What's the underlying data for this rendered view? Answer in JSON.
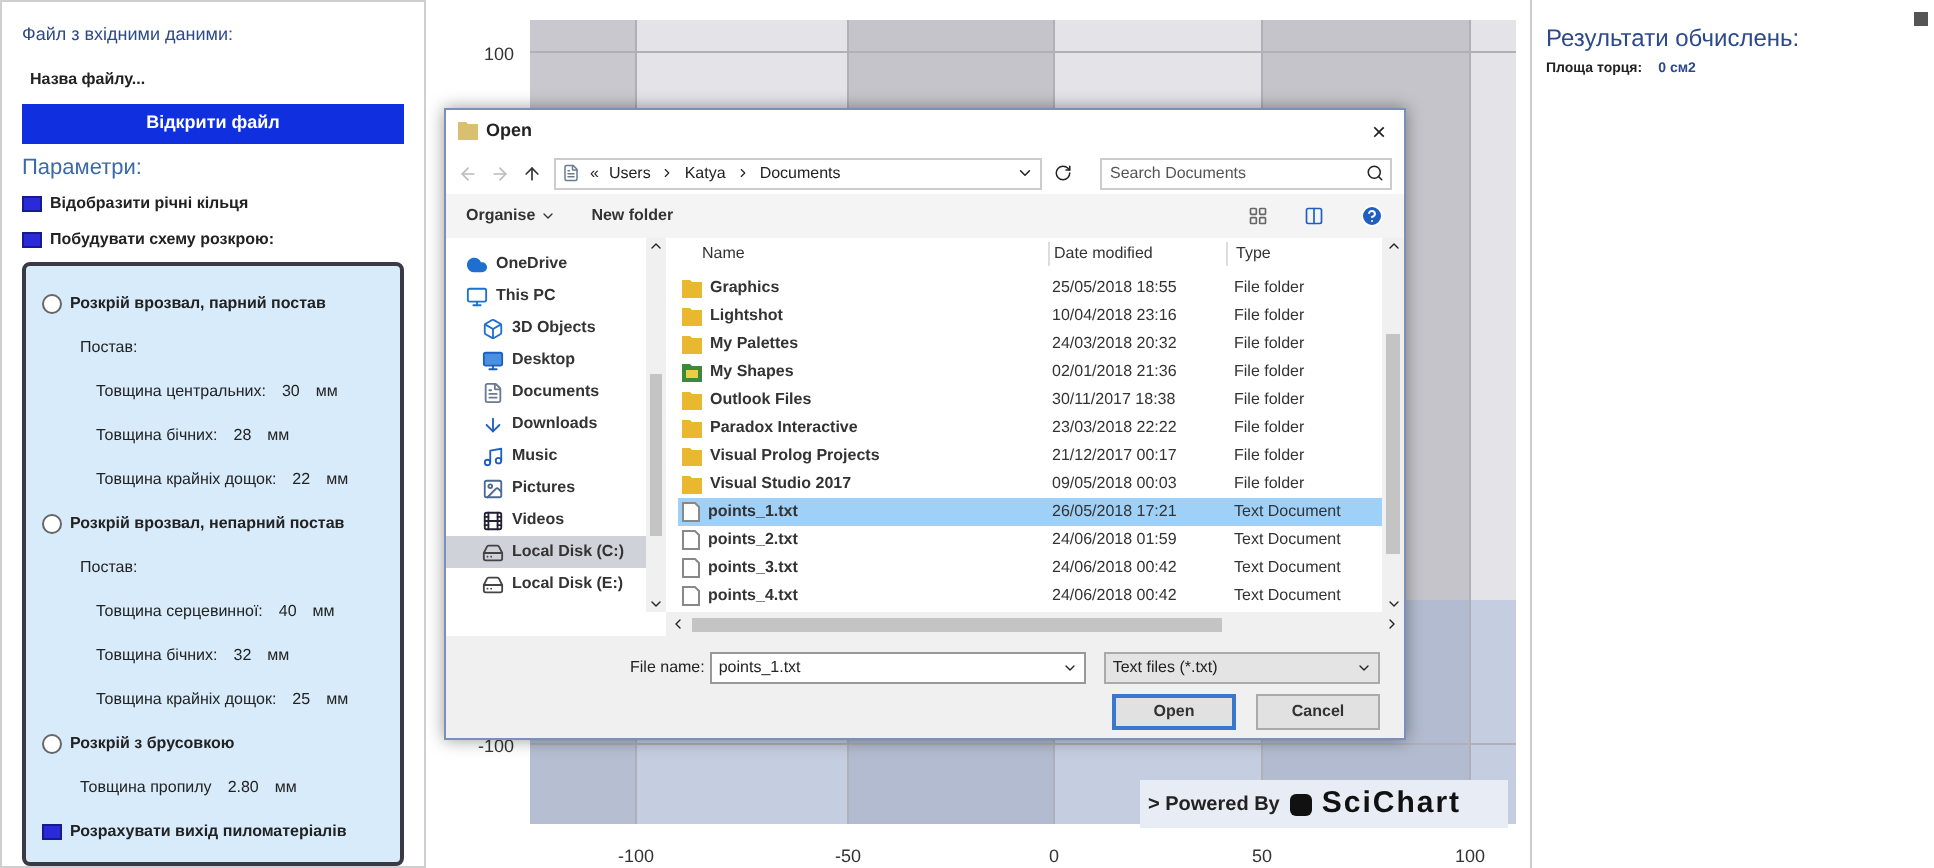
{
  "left_panel": {
    "input_label": "Файл з вхідними даними:",
    "file_name": "Назва файлу...",
    "open_button": "Відкрити файл",
    "params_heading": "Параметри:",
    "options": [
      {
        "label": "Відобразити річні кільця",
        "checked": true
      },
      {
        "label": "Побудувати схему розкрою:",
        "checked": true
      }
    ],
    "scheme_items": [
      {
        "kind": "radio",
        "label": "Розкрій врозвал, парний постав",
        "selected": false
      },
      {
        "kind": "heading",
        "label": "Постав:"
      },
      {
        "kind": "value",
        "label": "Товщина центральних:",
        "value": "30",
        "unit": "мм"
      },
      {
        "kind": "value",
        "label": "Товщина бічних:",
        "value": "28",
        "unit": "мм"
      },
      {
        "kind": "value",
        "label": "Товщина крайніх дощок:",
        "value": "22",
        "unit": "мм"
      },
      {
        "kind": "radio",
        "label": "Розкрій врозвал, непарний постав",
        "selected": false
      },
      {
        "kind": "heading",
        "label": "Постав:"
      },
      {
        "kind": "value",
        "label": "Товщина серцевинної:",
        "value": "40",
        "unit": "мм"
      },
      {
        "kind": "value",
        "label": "Товщина бічних:",
        "value": "32",
        "unit": "мм"
      },
      {
        "kind": "value",
        "label": "Товщина крайніх дощок:",
        "value": "25",
        "unit": "мм"
      },
      {
        "kind": "radio",
        "label": "Розкрій з брусовкою",
        "selected": false
      },
      {
        "kind": "setting",
        "label": "Товщина пропилу",
        "value": "2.80",
        "unit": "мм"
      },
      {
        "kind": "checkbox",
        "label": "Розрахувати вихід пиломатеріалів",
        "checked": true
      }
    ]
  },
  "chart": {
    "y_tick_labels": [
      "100",
      "-100"
    ],
    "x_tick_labels": [
      "-100",
      "-50",
      "0",
      "50",
      "100"
    ],
    "badge_prefix": "> Powered By",
    "badge_logo": "SciChart"
  },
  "dialog": {
    "title": "Open",
    "close": "×",
    "path_overflow": "«",
    "path": [
      "Users",
      "Katya",
      "Documents"
    ],
    "search_placeholder": "Search Documents",
    "toolbar": [
      {
        "label": "Organise",
        "dropdown": true
      },
      {
        "label": "New folder",
        "dropdown": false
      }
    ],
    "nav": [
      {
        "label": "OneDrive",
        "kind": "cloud",
        "selected": false
      },
      {
        "label": "This PC",
        "kind": "pc",
        "selected": false
      },
      {
        "label": "3D Objects",
        "kind": "cube",
        "selected": false
      },
      {
        "label": "Desktop",
        "kind": "desktop",
        "selected": false
      },
      {
        "label": "Documents",
        "kind": "document",
        "selected": false
      },
      {
        "label": "Downloads",
        "kind": "download",
        "selected": false
      },
      {
        "label": "Music",
        "kind": "music",
        "selected": false
      },
      {
        "label": "Pictures",
        "kind": "pictures",
        "selected": false
      },
      {
        "label": "Videos",
        "kind": "videos",
        "selected": false
      },
      {
        "label": "Local Disk (C:)",
        "kind": "disk",
        "selected": true
      },
      {
        "label": "Local Disk (E:)",
        "kind": "disk",
        "selected": false
      }
    ],
    "columns": [
      "Name",
      "Date modified",
      "Type"
    ],
    "rows": [
      {
        "name": "Graphics",
        "date": "25/05/2018 18:55",
        "type": "File folder",
        "kind": "folder",
        "selected": false
      },
      {
        "name": "Lightshot",
        "date": "10/04/2018 23:16",
        "type": "File folder",
        "kind": "folder",
        "selected": false
      },
      {
        "name": "My Palettes",
        "date": "24/03/2018 20:32",
        "type": "File folder",
        "kind": "folder",
        "selected": false
      },
      {
        "name": "My Shapes",
        "date": "02/01/2018 21:36",
        "type": "File folder",
        "kind": "shapes",
        "selected": false
      },
      {
        "name": "Outlook Files",
        "date": "30/11/2017 18:38",
        "type": "File folder",
        "kind": "folder",
        "selected": false
      },
      {
        "name": "Paradox Interactive",
        "date": "23/03/2018 22:22",
        "type": "File folder",
        "kind": "folder",
        "selected": false
      },
      {
        "name": "Visual Prolog Projects",
        "date": "21/12/2017 00:17",
        "type": "File folder",
        "kind": "folder",
        "selected": false
      },
      {
        "name": "Visual Studio 2017",
        "date": "09/05/2018 00:03",
        "type": "File folder",
        "kind": "folder",
        "selected": false
      },
      {
        "name": "points_1.txt",
        "date": "26/05/2018 17:21",
        "type": "Text Document",
        "kind": "text",
        "selected": true
      },
      {
        "name": "points_2.txt",
        "date": "24/06/2018 01:59",
        "type": "Text Document",
        "kind": "text",
        "selected": false
      },
      {
        "name": "points_3.txt",
        "date": "24/06/2018 00:42",
        "type": "Text Document",
        "kind": "text",
        "selected": false
      },
      {
        "name": "points_4.txt",
        "date": "24/06/2018 00:42",
        "type": "Text Document",
        "kind": "text",
        "selected": false
      }
    ],
    "file_name_label": "File name:",
    "file_name": "points_1.txt",
    "filter": "Text files (*.txt)",
    "buttons": [
      {
        "label": "Open",
        "default": true
      },
      {
        "label": "Cancel",
        "default": false
      }
    ]
  },
  "right_panel": {
    "title": "Результати обчислень:",
    "results": [
      {
        "label": "Площа торця:",
        "value": "0 см2"
      }
    ]
  }
}
